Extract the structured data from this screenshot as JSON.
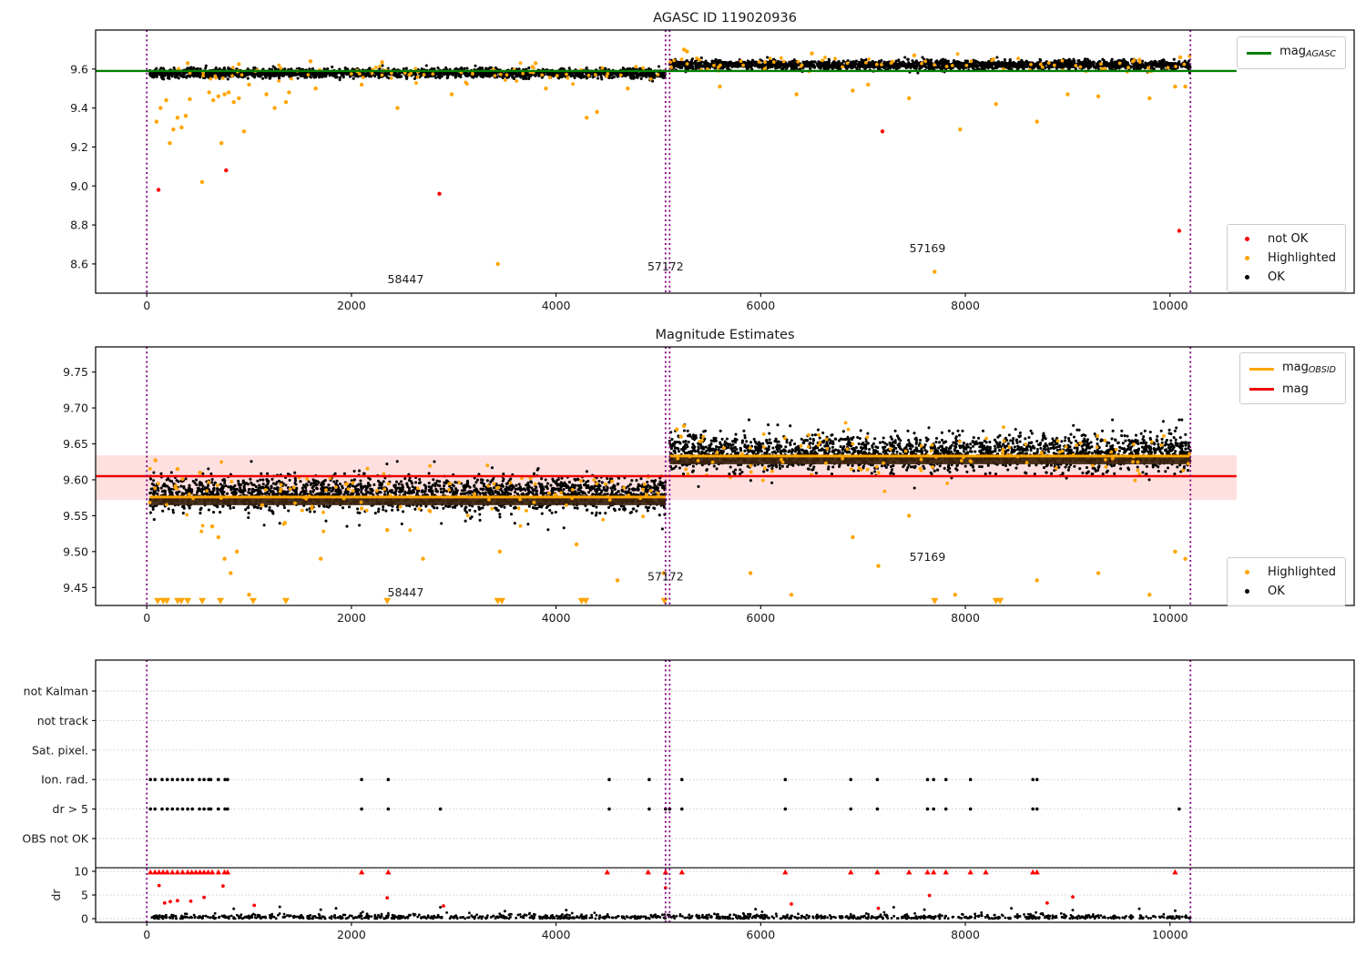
{
  "colors": {
    "ok": "#000000",
    "highlighted": "#ffa500",
    "not_ok": "#ff0000",
    "mag_agasc": "#008000",
    "mag": "#ee0000",
    "mag_band": "#ff0000",
    "obsid_boundary": "#800080",
    "grid": "#c8c8c8",
    "brown_overlap": "#3a220c",
    "spine": "#000000"
  },
  "chart_data": [
    {
      "id": "p1",
      "type": "scatter",
      "title": "AGASC ID 119020936",
      "xlim": [
        -500,
        11800
      ],
      "ylim": [
        8.45,
        9.8
      ],
      "xticks": [
        0,
        2000,
        4000,
        6000,
        8000,
        10000
      ],
      "yticks": [
        "8.6",
        "8.8",
        "9.0",
        "9.2",
        "9.4",
        "9.6"
      ],
      "mag_agasc_line": {
        "value": 9.59,
        "x0": -500,
        "x1": 10650
      },
      "obsid_boundaries": [
        0,
        5070,
        5110,
        10200
      ],
      "clouds": [
        {
          "x0": 30,
          "x1": 5070,
          "mean": 9.578,
          "sd": 0.011,
          "n": 1800,
          "color": "ok"
        },
        {
          "x0": 30,
          "x1": 5070,
          "mean": 9.578,
          "sd": 0.016,
          "n": 300,
          "color": "ok"
        },
        {
          "x0": 5110,
          "x1": 10200,
          "mean": 9.622,
          "sd": 0.011,
          "n": 1800,
          "color": "ok"
        },
        {
          "x0": 5110,
          "x1": 10200,
          "mean": 9.62,
          "sd": 0.016,
          "n": 300,
          "color": "ok"
        },
        {
          "x0": 30,
          "x1": 5070,
          "mean": 9.578,
          "sd": 0.022,
          "n": 80,
          "color": "highlighted"
        },
        {
          "x0": 5110,
          "x1": 10200,
          "mean": 9.622,
          "sd": 0.022,
          "n": 80,
          "color": "highlighted"
        }
      ],
      "highlighted_points": [
        [
          95,
          9.33
        ],
        [
          135,
          9.4
        ],
        [
          190,
          9.44
        ],
        [
          225,
          9.22
        ],
        [
          260,
          9.29
        ],
        [
          300,
          9.35
        ],
        [
          340,
          9.3
        ],
        [
          380,
          9.36
        ],
        [
          420,
          9.445
        ],
        [
          540,
          9.02
        ],
        [
          610,
          9.48
        ],
        [
          650,
          9.44
        ],
        [
          700,
          9.46
        ],
        [
          730,
          9.22
        ],
        [
          760,
          9.47
        ],
        [
          800,
          9.48
        ],
        [
          850,
          9.43
        ],
        [
          900,
          9.45
        ],
        [
          950,
          9.28
        ],
        [
          1000,
          9.52
        ],
        [
          1170,
          9.47
        ],
        [
          1250,
          9.4
        ],
        [
          1360,
          9.43
        ],
        [
          1390,
          9.48
        ],
        [
          1650,
          9.5
        ],
        [
          2100,
          9.52
        ],
        [
          2450,
          9.4
        ],
        [
          2980,
          9.47
        ],
        [
          3430,
          8.6
        ],
        [
          3900,
          9.5
        ],
        [
          4300,
          9.35
        ],
        [
          4400,
          9.38
        ],
        [
          4700,
          9.5
        ],
        [
          400,
          9.63
        ],
        [
          900,
          9.625
        ],
        [
          1600,
          9.64
        ],
        [
          2300,
          9.635
        ],
        [
          3800,
          9.63
        ],
        [
          5250,
          9.7
        ],
        [
          5280,
          9.69
        ],
        [
          5600,
          9.51
        ],
        [
          6350,
          9.47
        ],
        [
          6500,
          9.68
        ],
        [
          6900,
          9.49
        ],
        [
          7050,
          9.52
        ],
        [
          7450,
          9.45
        ],
        [
          7500,
          9.67
        ],
        [
          7700,
          8.56
        ],
        [
          7950,
          9.29
        ],
        [
          8300,
          9.42
        ],
        [
          8700,
          9.33
        ],
        [
          9000,
          9.47
        ],
        [
          9300,
          9.46
        ],
        [
          9800,
          9.45
        ],
        [
          10050,
          9.51
        ],
        [
          10100,
          9.66
        ],
        [
          10150,
          9.51
        ]
      ],
      "not_ok_points": [
        [
          115,
          8.98
        ],
        [
          775,
          9.08
        ],
        [
          2860,
          8.96
        ],
        [
          7190,
          9.28
        ],
        [
          10090,
          8.77
        ]
      ],
      "annotations": [
        {
          "text": "58447",
          "x": 2530,
          "y": 8.52
        },
        {
          "text": "57172",
          "x": 5070,
          "y": 8.585
        },
        {
          "text": "57169",
          "x": 7630,
          "y": 8.68
        }
      ],
      "legend_lines": [
        {
          "label": "mag",
          "sub": "AGASC",
          "color_key": "mag_agasc"
        }
      ],
      "legend_points": [
        {
          "label": "not OK",
          "color_key": "not_ok"
        },
        {
          "label": "Highlighted",
          "color_key": "highlighted"
        },
        {
          "label": "OK",
          "color_key": "ok"
        }
      ]
    },
    {
      "id": "p2",
      "type": "scatter",
      "title": "Magnitude Estimates",
      "xlim": [
        -500,
        11800
      ],
      "ylim": [
        9.425,
        9.785
      ],
      "xticks": [
        0,
        2000,
        4000,
        6000,
        8000,
        10000
      ],
      "yticks": [
        "9.45",
        "9.50",
        "9.55",
        "9.60",
        "9.65",
        "9.70",
        "9.75"
      ],
      "mag_line": {
        "value": 9.605,
        "x0": -500,
        "x1": 10650
      },
      "mag_band": {
        "lo": 9.572,
        "hi": 9.634,
        "x0": -500,
        "x1": 10650
      },
      "obsid_mag_lines": [
        {
          "x0": 30,
          "x1": 5070,
          "value": 9.576
        },
        {
          "x0": 5110,
          "x1": 10200,
          "value": 9.633
        }
      ],
      "obsid_boundaries": [
        0,
        5070,
        5110,
        10200
      ],
      "clouds": [
        {
          "x0": 30,
          "x1": 5070,
          "mean": 9.581,
          "sd": 0.011,
          "n": 1800,
          "color": "ok"
        },
        {
          "x0": 30,
          "x1": 5070,
          "mean": 9.578,
          "sd": 0.019,
          "n": 350,
          "color": "ok"
        },
        {
          "x0": 5110,
          "x1": 10200,
          "mean": 9.638,
          "sd": 0.012,
          "n": 1800,
          "color": "ok"
        },
        {
          "x0": 5110,
          "x1": 10200,
          "mean": 9.636,
          "sd": 0.019,
          "n": 350,
          "color": "ok"
        },
        {
          "x0": 30,
          "x1": 5070,
          "mean": 9.578,
          "sd": 0.02,
          "n": 110,
          "color": "highlighted"
        },
        {
          "x0": 5110,
          "x1": 10200,
          "mean": 9.634,
          "sd": 0.02,
          "n": 110,
          "color": "highlighted"
        }
      ],
      "highlighted_points": [
        [
          85,
          9.627
        ],
        [
          300,
          9.615
        ],
        [
          520,
          9.61
        ],
        [
          640,
          9.535
        ],
        [
          700,
          9.52
        ],
        [
          760,
          9.49
        ],
        [
          820,
          9.47
        ],
        [
          880,
          9.5
        ],
        [
          1000,
          9.44
        ],
        [
          1350,
          9.54
        ],
        [
          1700,
          9.49
        ],
        [
          2100,
          9.56
        ],
        [
          2350,
          9.53
        ],
        [
          2700,
          9.49
        ],
        [
          3450,
          9.5
        ],
        [
          4200,
          9.51
        ],
        [
          4600,
          9.46
        ],
        [
          5050,
          9.47
        ],
        [
          5180,
          9.67
        ],
        [
          5220,
          9.66
        ],
        [
          5250,
          9.675
        ],
        [
          5900,
          9.47
        ],
        [
          6300,
          9.44
        ],
        [
          6900,
          9.52
        ],
        [
          7150,
          9.48
        ],
        [
          7450,
          9.55
        ],
        [
          7900,
          9.44
        ],
        [
          8700,
          9.46
        ],
        [
          9300,
          9.47
        ],
        [
          9800,
          9.44
        ],
        [
          10050,
          9.5
        ],
        [
          10150,
          9.49
        ]
      ],
      "clipped_low_x": [
        107,
        160,
        196,
        302,
        338,
        400,
        542,
        720,
        1040,
        1360,
        2350,
        3430,
        3470,
        4250,
        4290,
        5060,
        7700,
        8300,
        8340
      ],
      "annotations": [
        {
          "text": "58447",
          "x": 2530,
          "y": 9.443
        },
        {
          "text": "57172",
          "x": 5070,
          "y": 9.465
        },
        {
          "text": "57169",
          "x": 7630,
          "y": 9.492
        }
      ],
      "legend_lines": [
        {
          "label": "mag",
          "sub": "OBSID",
          "color_key": "highlighted"
        },
        {
          "label": "mag",
          "sub": "",
          "color_key": "mag"
        }
      ],
      "legend_points": [
        {
          "label": "Highlighted",
          "color_key": "highlighted"
        },
        {
          "label": "OK",
          "color_key": "ok"
        }
      ]
    },
    {
      "id": "p3",
      "type": "flags",
      "rows": [
        "not Kalman",
        "not track",
        "Sat. pixel.",
        "Ion. rad.",
        "dr > 5",
        "OBS not OK"
      ],
      "dr_label": "dr",
      "dr_ticks": [
        "10",
        "5",
        "0"
      ],
      "xticks": [
        0,
        2000,
        4000,
        6000,
        8000,
        10000
      ],
      "obsid_boundaries": [
        0,
        5070,
        5110,
        10200
      ],
      "separator_dr_value": 10.75,
      "flag_rows_points": {
        "Ion. rad.": [
          36,
          80,
          150,
          200,
          250,
          300,
          350,
          400,
          445,
          515,
          560,
          605,
          625,
          700,
          765,
          790,
          2100,
          2360,
          4520,
          4910,
          5230,
          6240,
          6880,
          7140,
          7630,
          7690,
          7810,
          8050,
          8660,
          8700
        ],
        "dr > 5": [
          36,
          80,
          150,
          200,
          250,
          300,
          350,
          400,
          445,
          515,
          560,
          605,
          625,
          700,
          765,
          790,
          2100,
          2360,
          2870,
          4520,
          4910,
          5070,
          5110,
          5230,
          6240,
          6880,
          7140,
          7630,
          7690,
          7810,
          8050,
          8660,
          8700,
          10090
        ]
      },
      "dr_red_clipped_x": [
        36,
        80,
        120,
        160,
        200,
        250,
        300,
        350,
        400,
        440,
        480,
        520,
        560,
        600,
        640,
        700,
        760,
        790,
        2100,
        2360,
        4500,
        4900,
        5070,
        5230,
        6240,
        6880,
        7140,
        7450,
        7630,
        7690,
        7810,
        8050,
        8200,
        8660,
        8700,
        10050
      ],
      "dr_red_points": [
        [
          120,
          7.0
        ],
        [
          175,
          3.3
        ],
        [
          230,
          3.6
        ],
        [
          300,
          3.8
        ],
        [
          430,
          3.7
        ],
        [
          560,
          4.5
        ],
        [
          745,
          6.9
        ],
        [
          1050,
          2.8
        ],
        [
          2350,
          4.4
        ],
        [
          2900,
          2.7
        ],
        [
          5070,
          6.5
        ],
        [
          6300,
          3.1
        ],
        [
          7150,
          2.2
        ],
        [
          7650,
          4.9
        ],
        [
          8800,
          3.3
        ],
        [
          9050,
          4.6
        ]
      ],
      "dr_black_points": [
        [
          850,
          2.1
        ],
        [
          1300,
          2.5
        ],
        [
          1700,
          1.9
        ],
        [
          1850,
          2.2
        ],
        [
          2870,
          2.4
        ],
        [
          3500,
          1.6
        ],
        [
          4100,
          1.8
        ],
        [
          5950,
          2.0
        ],
        [
          7300,
          2.4
        ],
        [
          7600,
          1.9
        ],
        [
          8450,
          2.2
        ],
        [
          9050,
          1.8
        ],
        [
          9700,
          2.1
        ],
        [
          10050,
          1.7
        ]
      ],
      "dr_black_band": {
        "x0": 30,
        "x1": 10200,
        "n": 1100,
        "scale": 0.45,
        "max": 2.0
      }
    }
  ]
}
